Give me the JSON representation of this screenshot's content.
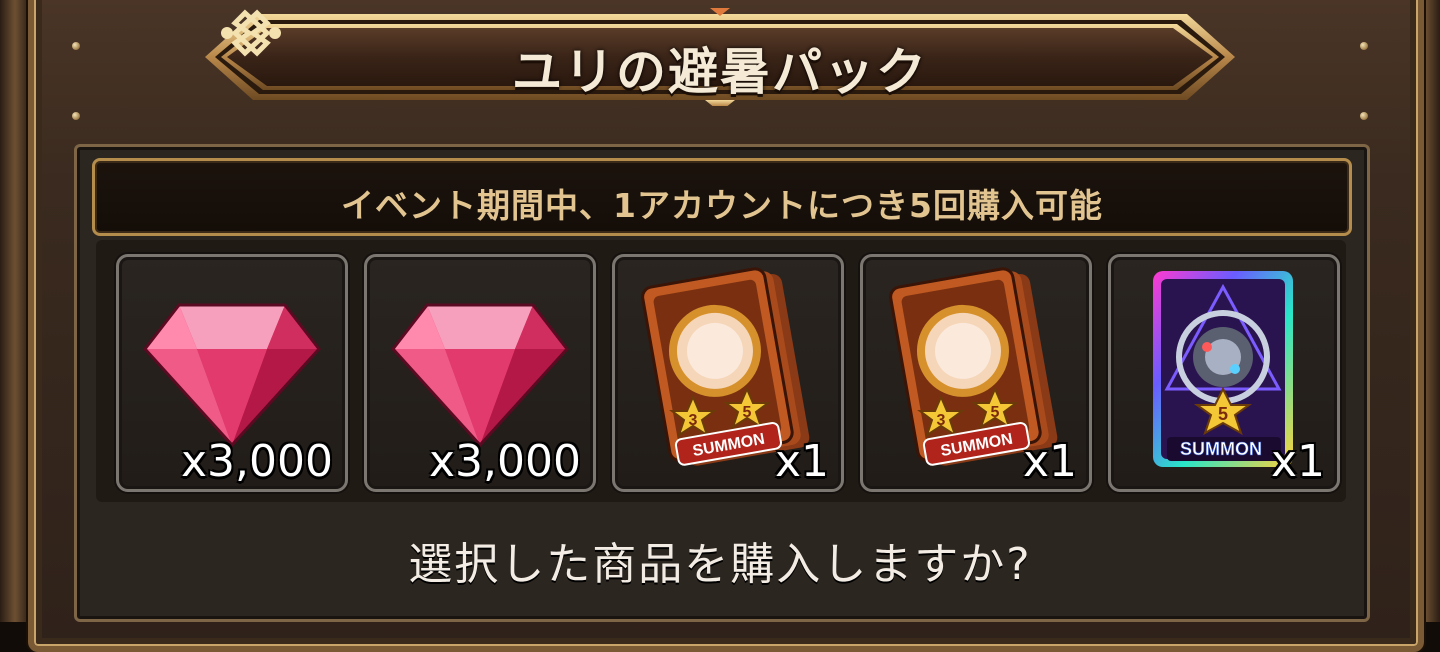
{
  "header": {
    "title": "ユリの避暑パック"
  },
  "notice": {
    "text": "イベント期間中、1アカウントにつき5回購入可能"
  },
  "items": [
    {
      "kind": "gem",
      "icon": "ruby-gem-icon",
      "quantity": "x3,000"
    },
    {
      "kind": "gem",
      "icon": "ruby-gem-icon",
      "quantity": "x3,000"
    },
    {
      "kind": "summon",
      "icon": "summon-ticket-3-5-icon",
      "stars_left": "3",
      "stars_right": "5",
      "label": "SUMMON",
      "quantity": "x1"
    },
    {
      "kind": "summon",
      "icon": "summon-ticket-3-5-icon",
      "stars_left": "3",
      "stars_right": "5",
      "label": "SUMMON",
      "quantity": "x1"
    },
    {
      "kind": "summon-rainbow",
      "icon": "summon-ticket-5-star-icon",
      "stars": "5",
      "label": "SUMMON",
      "quantity": "x1"
    }
  ],
  "confirm": {
    "question": "選択した商品を購入しますか?"
  },
  "colors": {
    "accent": "#e2c490",
    "frame_gold": "#b48c4c",
    "gem": "#e8406e"
  }
}
